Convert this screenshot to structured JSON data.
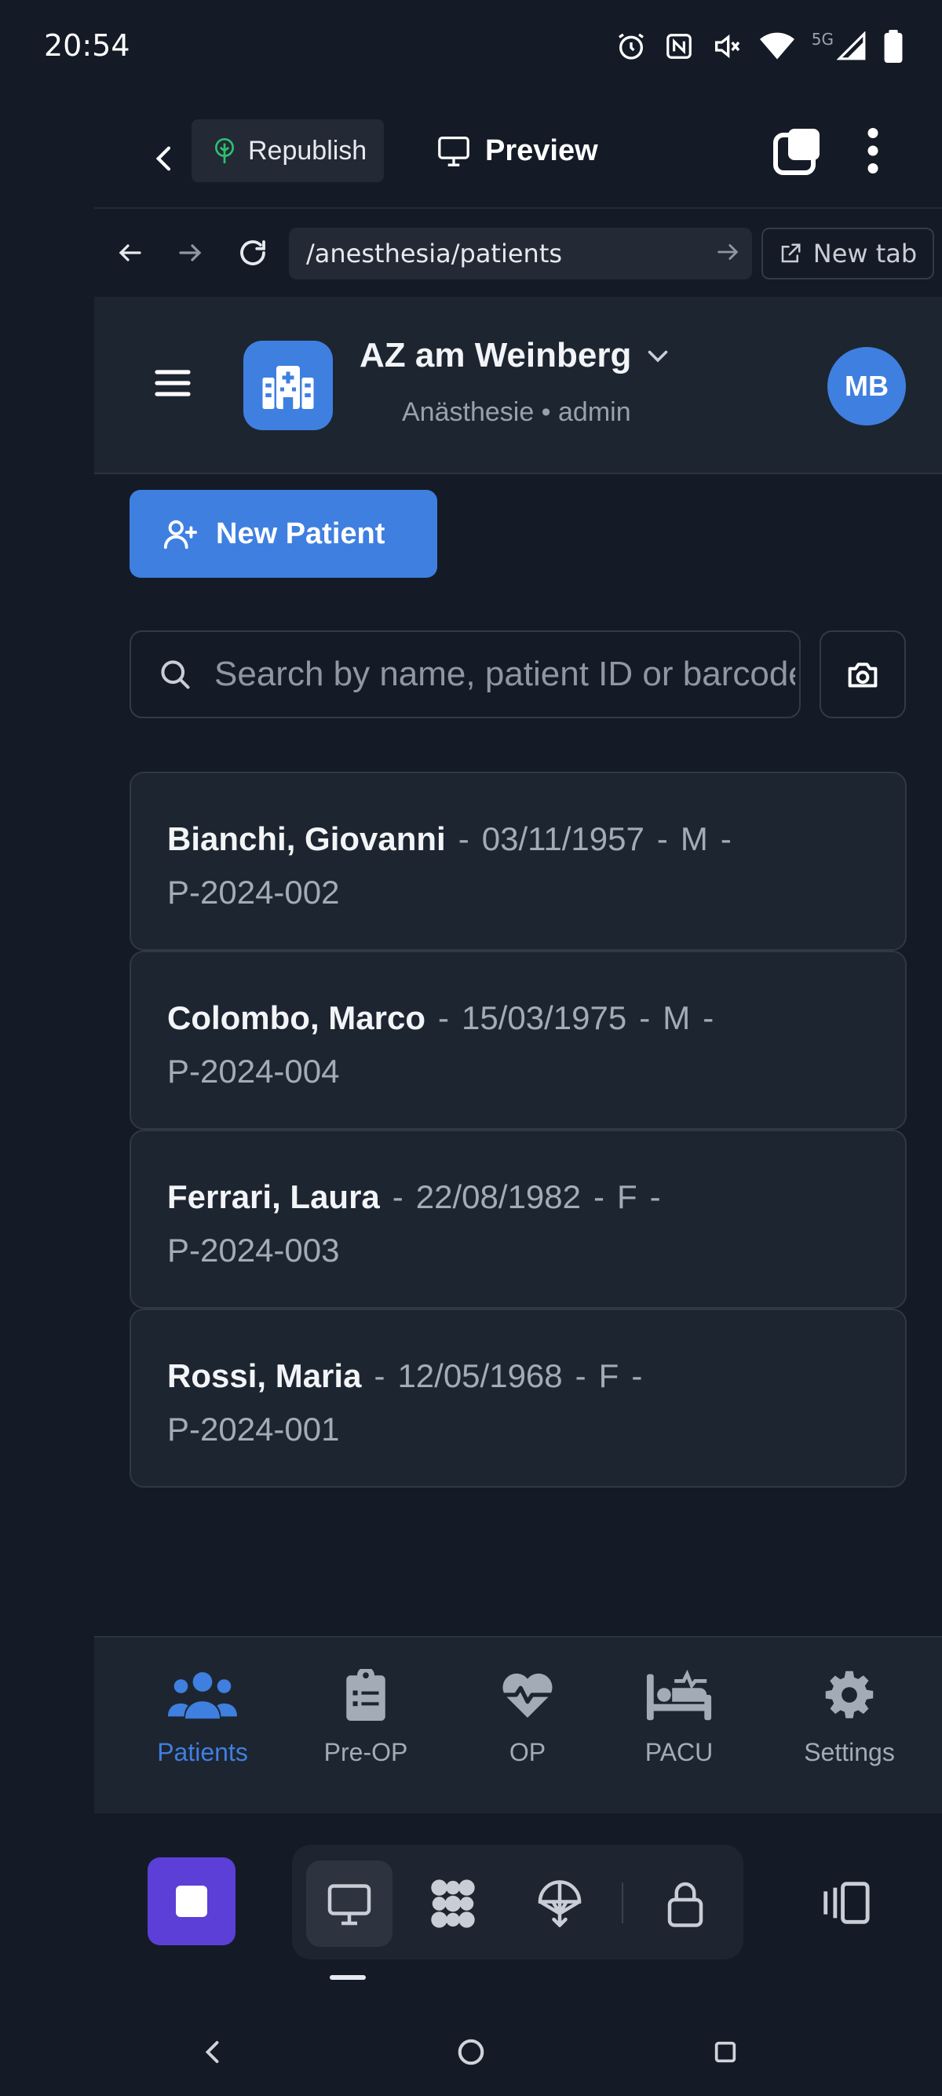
{
  "status_bar": {
    "time": "20:54",
    "network": "5G"
  },
  "toolbar": {
    "republish_label": "Republish",
    "preview_label": "Preview"
  },
  "browser": {
    "url": "/anesthesia/patients",
    "new_tab_label": "New tab"
  },
  "header": {
    "hospital_name": "AZ am Weinberg",
    "subtitle": "Anästhesie • admin",
    "avatar_initials": "MB"
  },
  "actions": {
    "new_patient_label": "New Patient"
  },
  "search": {
    "placeholder": "Search by name, patient ID or barcode",
    "value": ""
  },
  "patients": [
    {
      "name": "Bianchi, Giovanni",
      "dob": "03/11/1957",
      "sex": "M",
      "id": "P-2024-002"
    },
    {
      "name": "Colombo, Marco",
      "dob": "15/03/1975",
      "sex": "M",
      "id": "P-2024-004"
    },
    {
      "name": "Ferrari, Laura",
      "dob": "22/08/1982",
      "sex": "F",
      "id": "P-2024-003"
    },
    {
      "name": "Rossi, Maria",
      "dob": "12/05/1968",
      "sex": "F",
      "id": "P-2024-001"
    }
  ],
  "bottom_nav": {
    "items": [
      {
        "label": "Patients",
        "icon": "users-icon",
        "active": true
      },
      {
        "label": "Pre-OP",
        "icon": "clipboard-list-icon",
        "active": false
      },
      {
        "label": "OP",
        "icon": "heart-pulse-icon",
        "active": false
      },
      {
        "label": "PACU",
        "icon": "bed-pulse-icon",
        "active": false
      },
      {
        "label": "Settings",
        "icon": "gear-icon",
        "active": false
      }
    ]
  },
  "colors": {
    "background": "#141b26",
    "surface": "#1d2530",
    "accent": "#3f7fe0",
    "stop_button": "#5b3fd6",
    "muted_text": "#a3abb6"
  }
}
